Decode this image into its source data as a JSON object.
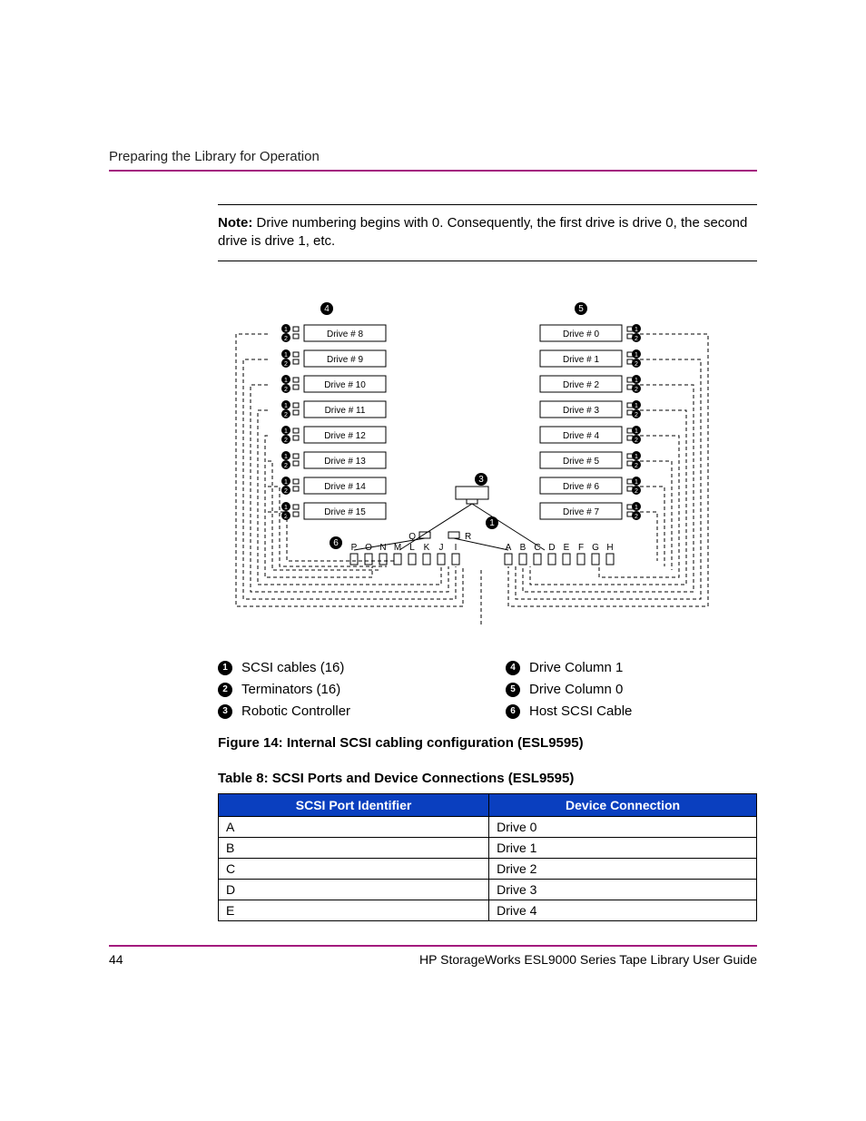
{
  "header": {
    "section_title": "Preparing the Library for Operation"
  },
  "note": {
    "label": "Note:",
    "text": "Drive numbering begins with 0. Consequently, the first drive is drive 0, the second drive is drive 1, etc."
  },
  "diagram": {
    "callout_top_left": "4",
    "callout_top_right": "5",
    "callout_center": "3",
    "callout_center_right": "1",
    "callout_bottom_left": "6",
    "left_drives": [
      "Drive # 8",
      "Drive # 9",
      "Drive # 10",
      "Drive # 11",
      "Drive # 12",
      "Drive # 13",
      "Drive # 14",
      "Drive # 15"
    ],
    "right_drives": [
      "Drive # 0",
      "Drive # 1",
      "Drive # 2",
      "Drive # 3",
      "Drive # 4",
      "Drive # 5",
      "Drive # 6",
      "Drive # 7"
    ],
    "port_row_upper_left": "Q",
    "port_row_upper_right": "R",
    "port_row_left": [
      "P",
      "O",
      "N",
      "M",
      "L",
      "K",
      "J",
      "I"
    ],
    "port_row_right": [
      "A",
      "B",
      "C",
      "D",
      "E",
      "F",
      "G",
      "H"
    ],
    "connector_badge_1": "1",
    "connector_badge_2": "2"
  },
  "legend": {
    "left": [
      {
        "n": "1",
        "t": "SCSI cables (16)"
      },
      {
        "n": "2",
        "t": "Terminators (16)"
      },
      {
        "n": "3",
        "t": "Robotic Controller"
      }
    ],
    "right": [
      {
        "n": "4",
        "t": "Drive Column 1"
      },
      {
        "n": "5",
        "t": "Drive Column 0"
      },
      {
        "n": "6",
        "t": "Host SCSI Cable"
      }
    ]
  },
  "figure_caption": "Figure 14:  Internal SCSI cabling configuration (ESL9595)",
  "table_caption": "Table 8:  SCSI Ports and Device Connections (ESL9595)",
  "table": {
    "head": [
      "SCSI Port Identifier",
      "Device Connection"
    ],
    "rows": [
      [
        "A",
        "Drive 0"
      ],
      [
        "B",
        "Drive 1"
      ],
      [
        "C",
        "Drive 2"
      ],
      [
        "D",
        "Drive 3"
      ],
      [
        "E",
        "Drive 4"
      ]
    ]
  },
  "footer": {
    "page": "44",
    "doc": "HP StorageWorks ESL9000 Series Tape Library User Guide"
  }
}
